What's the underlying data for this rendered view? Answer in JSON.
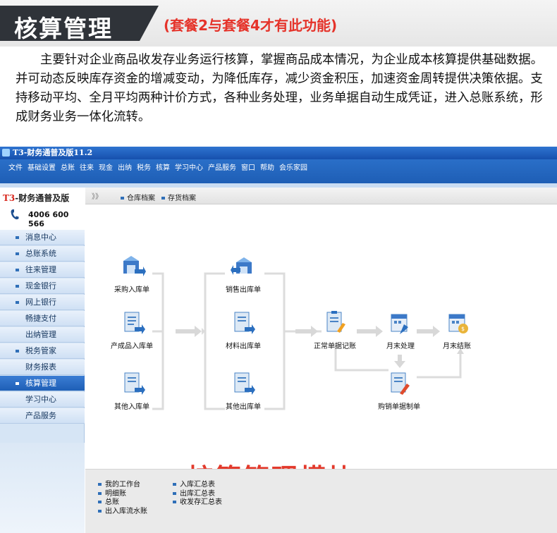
{
  "banner": {
    "title": "核算管理",
    "subtitle": "(套餐2与套餐4才有此功能)",
    "intro": "主要针对企业商品收发存业务运行核算，掌握商品成本情况，为企业成本核算提供基础数据。并可动态反映库存资金的增减变动，为降低库存，减少资金积压，加速资金周转提供决策依据。支持移动平均、全月平均两种计价方式，各种业务处理，业务单据自动生成凭证，进入总账系统，形成财务业务一体化流转。"
  },
  "app": {
    "window_title": "T3-财务通普及版11.2",
    "menu": [
      "文件",
      "基础设置",
      "总账",
      "往来",
      "现金",
      "出纳",
      "税务",
      "核算",
      "学习中心",
      "产品服务",
      "窗口",
      "帮助",
      "会乐家园"
    ],
    "brand": {
      "prefix": "T3",
      "name": "-财务通普及版",
      "phone": "4006 600 566"
    },
    "sidebar": [
      {
        "label": "消息中心",
        "bullet": true,
        "active": false
      },
      {
        "label": "总账系统",
        "bullet": true,
        "active": false
      },
      {
        "label": "往来管理",
        "bullet": true,
        "active": false
      },
      {
        "label": "现金银行",
        "bullet": true,
        "active": false
      },
      {
        "label": "网上银行",
        "bullet": true,
        "active": false
      },
      {
        "label": "畅捷支付",
        "bullet": false,
        "active": false
      },
      {
        "label": "出纳管理",
        "bullet": false,
        "active": false
      },
      {
        "label": "税务管家",
        "bullet": true,
        "active": false
      },
      {
        "label": "财务报表",
        "bullet": false,
        "active": false
      },
      {
        "label": "核算管理",
        "bullet": true,
        "active": true
      },
      {
        "label": "学习中心",
        "bullet": false,
        "active": false
      },
      {
        "label": "产品服务",
        "bullet": false,
        "active": false
      }
    ],
    "tabs": {
      "arrow": "》》",
      "items": [
        "仓库档案",
        "存货档案"
      ]
    },
    "flow": {
      "nodes": [
        "采购入库单",
        "产成品入库单",
        "其他入库单",
        "销售出库单",
        "材料出库单",
        "其他出库单",
        "正常单据记账",
        "月末处理",
        "月末结账",
        "购销单据制单"
      ]
    },
    "module_title": "核算管理模块",
    "reports_left": [
      "我的工作台",
      "明细账",
      "总账",
      "出入库流水账"
    ],
    "reports_right": [
      "入库汇总表",
      "出库汇总表",
      "收发存汇总表"
    ]
  }
}
